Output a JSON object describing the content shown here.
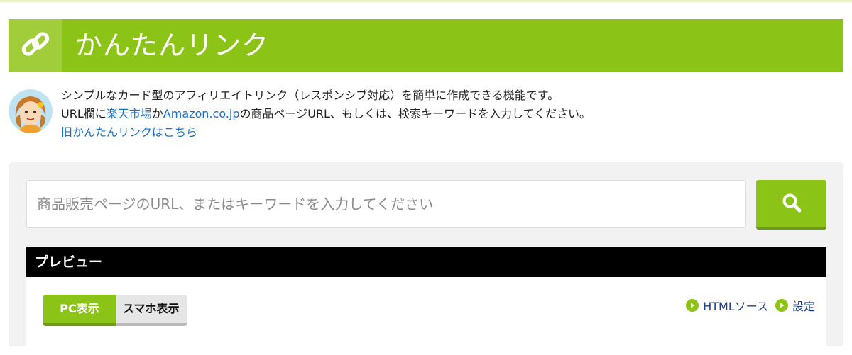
{
  "header": {
    "title": "かんたんリンク",
    "icon": "chain-link-icon"
  },
  "intro": {
    "line1": "シンプルなカード型のアフィリエイトリンク（レスポンシブ対応）を簡単に作成できる機能です。",
    "line2_prefix": "URL欄に",
    "rakuten_link": "楽天市場",
    "line2_mid": "か",
    "amazon_link": "Amazon.co.jp",
    "line2_suffix": "の商品ページURL、もしくは、検索キーワードを入力してください。",
    "old_link": "旧かんたんリンクはこちら"
  },
  "search": {
    "placeholder": "商品販売ページのURL、またはキーワードを入力してください",
    "value": "",
    "button_icon": "search-icon"
  },
  "preview": {
    "title": "プレビュー",
    "tabs": [
      {
        "label": "PC表示",
        "active": true
      },
      {
        "label": "スマホ表示",
        "active": false
      }
    ],
    "links": [
      {
        "label": "HTMLソース",
        "icon": "play-circle-icon"
      },
      {
        "label": "設定",
        "icon": "play-circle-icon"
      }
    ]
  },
  "colors": {
    "brand_green": "#8cc317",
    "link_blue": "#1a6fc7",
    "preview_bar": "#000000"
  }
}
